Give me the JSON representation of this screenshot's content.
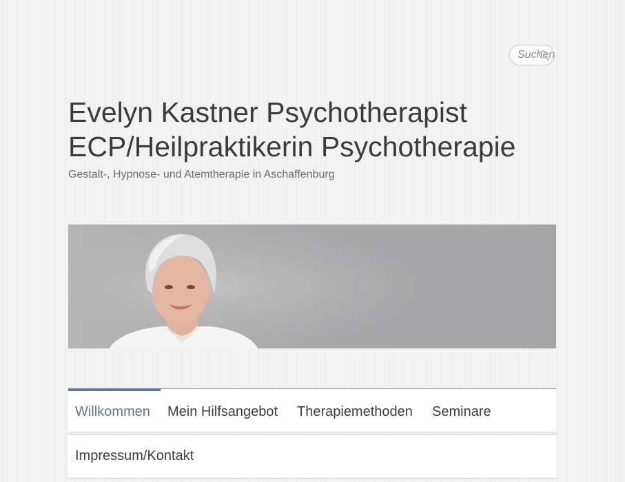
{
  "search": {
    "placeholder": "Suchen"
  },
  "header": {
    "title_line1": "Evelyn Kastner Psychotherapist",
    "title_line2": "ECP/Heilpraktikerin Psychotherapie",
    "tagline": "Gestalt-, Hypnose- und Atemtherapie in Aschaffenburg"
  },
  "nav": {
    "items": [
      {
        "label": "Willkommen",
        "active": true
      },
      {
        "label": "Mein Hilfsangebot"
      },
      {
        "label": "Therapiemethoden"
      },
      {
        "label": "Seminare"
      },
      {
        "label": "Impressum/Kontakt"
      }
    ]
  },
  "colors": {
    "accent": "#5b7a99",
    "title": "#3b3b3b",
    "tagline": "#6e6e6e"
  },
  "icons": {
    "search": "magnifier-icon"
  }
}
